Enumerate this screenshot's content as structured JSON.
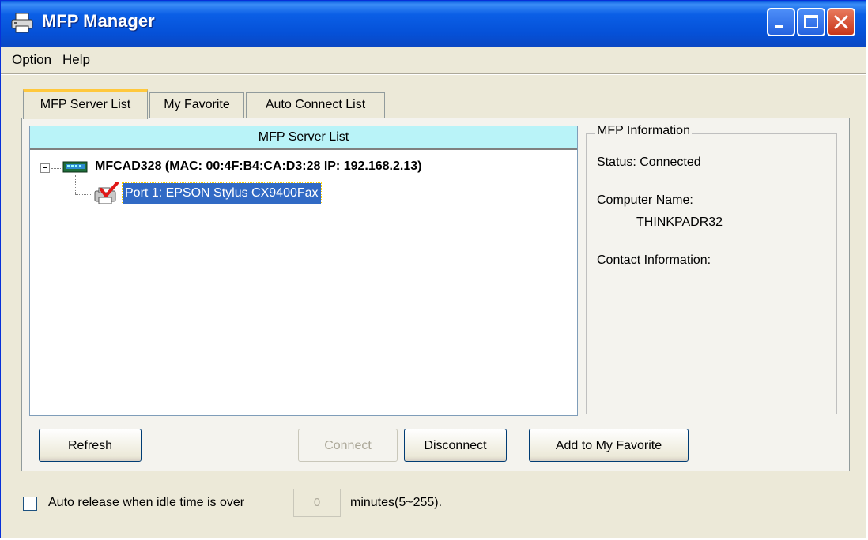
{
  "window": {
    "title": "MFP Manager",
    "title_bar_color": "#0a5de0",
    "icon": "printer-icon"
  },
  "menu": {
    "items": [
      {
        "label": "Option",
        "mnemonic": "O"
      },
      {
        "label": "Help",
        "mnemonic": "H"
      }
    ]
  },
  "tabs": [
    {
      "label": "MFP Server List",
      "active": true
    },
    {
      "label": "My Favorite",
      "active": false
    },
    {
      "label": "Auto Connect List",
      "active": false
    }
  ],
  "server_list": {
    "header": "MFP Server List",
    "header_color": "#b9f3f8",
    "server": {
      "label": "MFCAD328 (MAC: 00:4F:B4:CA:D3:28   IP: 192.168.2.13)",
      "expanded": true,
      "icon": "network-server-icon"
    },
    "port": {
      "label": "Port 1: EPSON Stylus CX9400Fax",
      "selected": true,
      "icon": "printer-connected-icon"
    }
  },
  "mfp_information": {
    "legend": "MFP Information",
    "status": "Status: Connected",
    "computer_name_label": "Computer Name:",
    "computer_name_value": "THINKPADR32",
    "contact_label": "Contact Information:"
  },
  "buttons": {
    "refresh": {
      "label": "Refresh",
      "mnemonic": "R",
      "enabled": true
    },
    "connect": {
      "label": "Connect",
      "mnemonic": "C",
      "enabled": false
    },
    "disconnect": {
      "label": "Disconnect",
      "mnemonic": "D",
      "enabled": true
    },
    "add_favorite": {
      "label": "Add to My Favorite",
      "mnemonic": "F",
      "enabled": true
    }
  },
  "auto_release": {
    "checked": false,
    "label": "Auto release when idle time is over",
    "value": "0",
    "suffix": "minutes(5~255)."
  },
  "selection_color": "#316ac5"
}
